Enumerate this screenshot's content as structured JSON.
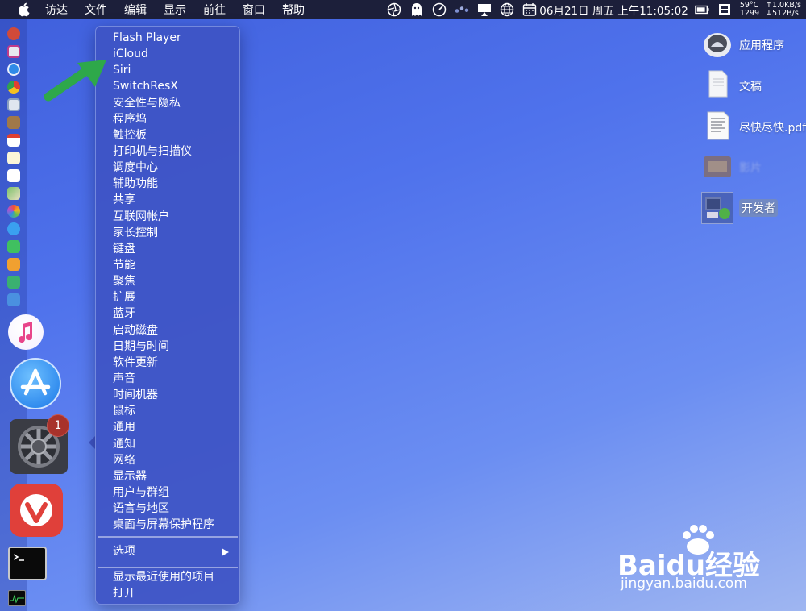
{
  "menubar": {
    "items": [
      "访达",
      "文件",
      "编辑",
      "显示",
      "前往",
      "窗口",
      "帮助"
    ],
    "status": {
      "datetime": "06月21日 周五 上午11:05:02",
      "temp": "59°C",
      "cpu": "1299",
      "upload": "↑1.0KB/s",
      "download": "↓512B/s"
    }
  },
  "context_menu": {
    "items": [
      "Flash Player",
      "iCloud",
      "Siri",
      "SwitchResX",
      "安全性与隐私",
      "程序坞",
      "触控板",
      "打印机与扫描仪",
      "调度中心",
      "辅助功能",
      "共享",
      "互联网帐户",
      "家长控制",
      "键盘",
      "节能",
      "聚焦",
      "扩展",
      "蓝牙",
      "启动磁盘",
      "日期与时间",
      "软件更新",
      "声音",
      "时间机器",
      "鼠标",
      "通用",
      "通知",
      "网络",
      "显示器",
      "用户与群组",
      "语言与地区",
      "桌面与屏幕保护程序"
    ],
    "options_label": "选项",
    "recent_label": "显示最近使用的项目",
    "open_label": "打开"
  },
  "dock": {
    "system_prefs_badge": "1"
  },
  "desktop": {
    "icons": [
      "应用程序",
      "文稿",
      "尽快尽快.pdf",
      "影片",
      "开发者"
    ]
  },
  "watermark": {
    "brand": "Baidu经验",
    "url": "jingyan.baidu.com"
  },
  "colors": {
    "accent_arrow": "#2ea84a",
    "badge": "#a8322b"
  }
}
